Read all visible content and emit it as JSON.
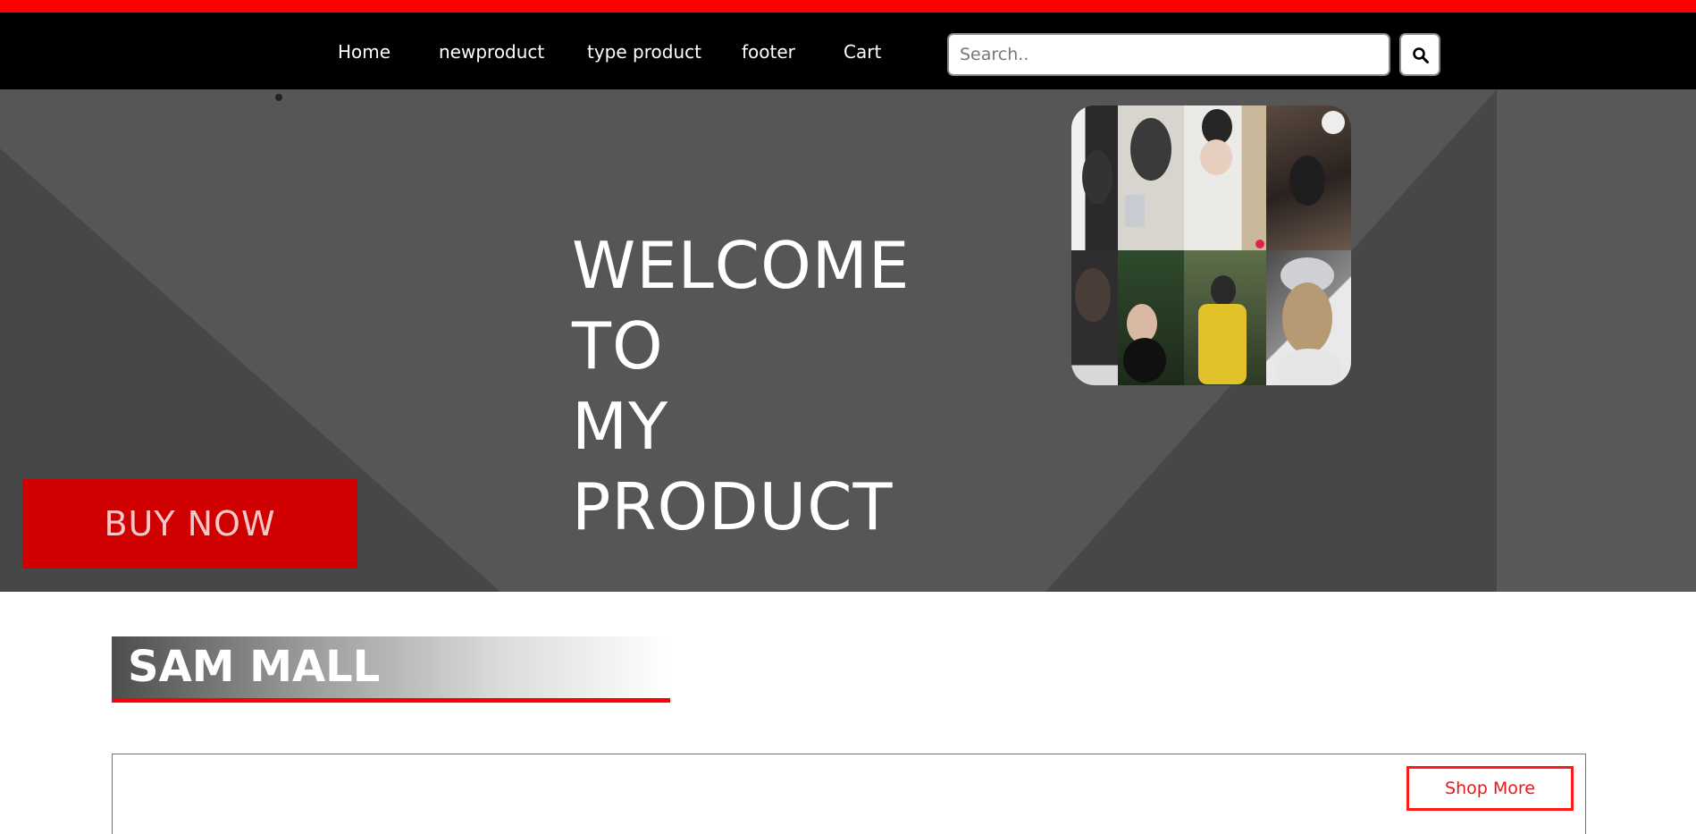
{
  "nav": {
    "links": [
      "Home",
      "newproduct",
      "type product",
      "footer",
      "Cart"
    ],
    "search_placeholder": "Search..",
    "search_icon": "search-icon"
  },
  "hero": {
    "title_line1": "WELCOME TO",
    "title_line2": "MY PRODUCT",
    "buy_label": "BUY NOW",
    "collage_image": "photo-collage"
  },
  "section": {
    "title": "SAM MALL",
    "shop_more_label": "Shop More"
  },
  "colors": {
    "accent_red": "#ff0000",
    "nav_background": "#000000",
    "hero_background": "#565656",
    "buy_button": "#d00000"
  }
}
